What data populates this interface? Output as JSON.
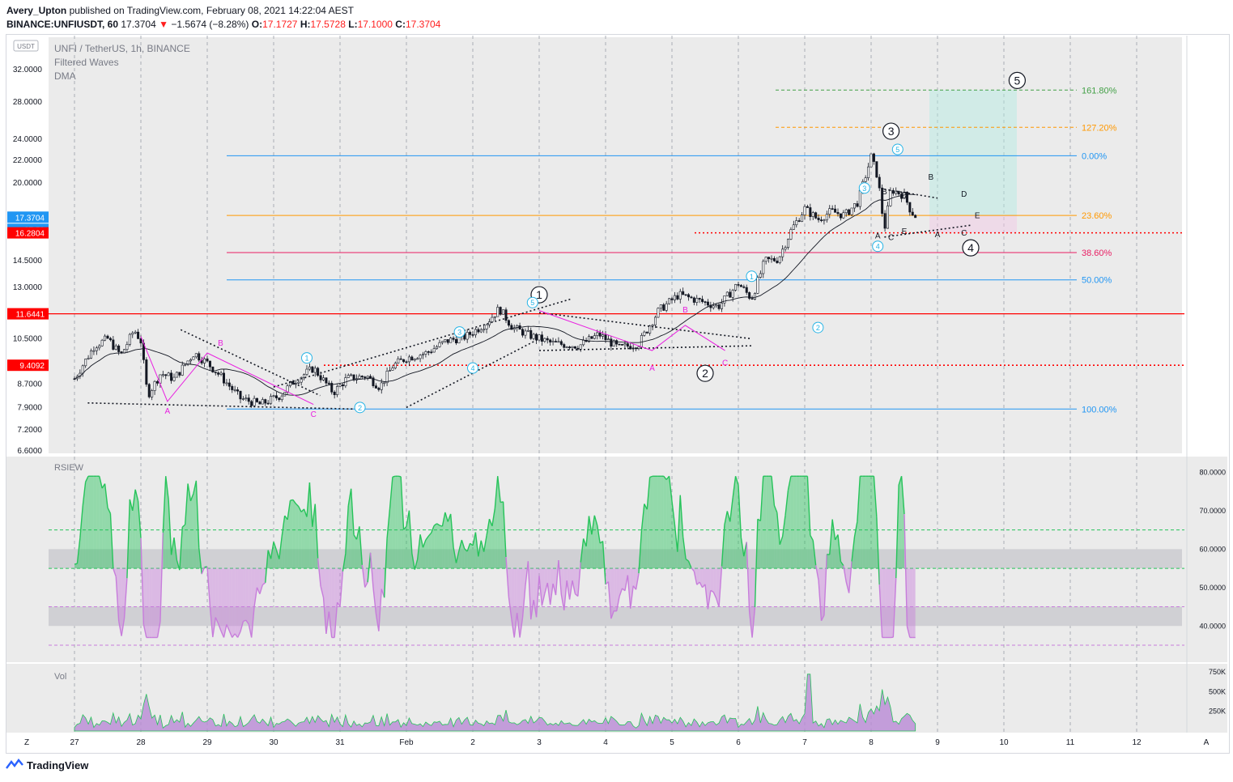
{
  "header": {
    "author": "Avery_Upton",
    "published_text": "published on TradingView.com, February 08, 2021 14:22:04 AEST",
    "symbol_line": "BINANCE:UNFIUSDT, 60",
    "last": "17.3704",
    "change": "−1.5674 (−8.28%)",
    "o": "17.1727",
    "h": "17.5728",
    "l": "17.1000",
    "c": "17.3704"
  },
  "legend": {
    "title": "UNFI / TetherUS, 1h, BINANCE",
    "ind1": "Filtered Waves",
    "ind2": "DMA",
    "rsi": "RSIEW",
    "vol": "Vol",
    "currency": "USDT"
  },
  "footer": {
    "brand": "TradingView"
  },
  "colors": {
    "candle": "#131722",
    "fib_blue": "#2196f3",
    "fib_orange": "#ff9800",
    "fib_crimson": "#e91e63",
    "fib_green": "#43a047",
    "red_level": "#ff0000",
    "rsi_up": "#26c35a",
    "rsi_down": "#c77ddb",
    "wave_marker": "#26b4e6",
    "corrective": "#e91ee0"
  },
  "chart_data": {
    "type": "candlestick",
    "price_axis": {
      "scale": "log",
      "ticks": [
        "32.0000",
        "28.0000",
        "24.0000",
        "22.0000",
        "20.0000",
        "17.3704",
        "16.2804",
        "14.5000",
        "13.0000",
        "11.6441",
        "10.5000",
        "9.4092",
        "8.7000",
        "7.9000",
        "7.2000",
        "6.6000"
      ],
      "ylim": [
        6.6,
        32.0
      ]
    },
    "price_tags": [
      {
        "value": "17.3704",
        "color": "#2196f3"
      },
      {
        "value": "37:59",
        "color": "#2196f3"
      },
      {
        "value": "16.2804",
        "color": "#ff0000"
      },
      {
        "value": "11.6441",
        "color": "#ff0000"
      },
      {
        "value": "9.4092",
        "color": "#ff0000"
      }
    ],
    "x_axis": {
      "ticks": [
        "27",
        "28",
        "29",
        "30",
        "31",
        "Feb",
        "2",
        "3",
        "4",
        "5",
        "6",
        "7",
        "8",
        "9",
        "10",
        "11",
        "12"
      ]
    },
    "fib_levels": [
      {
        "label": "161.80%",
        "price": 29.4,
        "color": "#43a047"
      },
      {
        "label": "127.20%",
        "price": 25.2,
        "color": "#ff9800"
      },
      {
        "label": "0.00%",
        "price": 22.4,
        "color": "#2196f3"
      },
      {
        "label": "23.60%",
        "price": 17.5,
        "color": "#ff9800"
      },
      {
        "label": "38.60%",
        "price": 15.0,
        "color": "#e91e63"
      },
      {
        "label": "50.00%",
        "price": 13.4,
        "color": "#2196f3"
      },
      {
        "label": "100.00%",
        "price": 7.85,
        "color": "#2196f3"
      }
    ],
    "horizontal_levels": [
      {
        "price": 11.6441,
        "style": "solid",
        "color": "#ff0000"
      },
      {
        "price": 16.2804,
        "style": "dotted",
        "color": "#ff0000"
      },
      {
        "price": 9.4092,
        "style": "dotted",
        "color": "#ff0000"
      }
    ],
    "price_path": [
      {
        "t": 0.0,
        "p": 8.9
      },
      {
        "t": 0.3,
        "p": 10.2
      },
      {
        "t": 0.5,
        "p": 10.5
      },
      {
        "t": 0.7,
        "p": 9.8
      },
      {
        "t": 0.9,
        "p": 10.9
      },
      {
        "t": 1.0,
        "p": 10.4
      },
      {
        "t": 1.1,
        "p": 8.3
      },
      {
        "t": 1.3,
        "p": 9.1
      },
      {
        "t": 1.5,
        "p": 8.9
      },
      {
        "t": 1.8,
        "p": 9.9
      },
      {
        "t": 2.0,
        "p": 9.5
      },
      {
        "t": 2.2,
        "p": 9.0
      },
      {
        "t": 2.5,
        "p": 8.2
      },
      {
        "t": 2.8,
        "p": 8.0
      },
      {
        "t": 3.1,
        "p": 8.3
      },
      {
        "t": 3.3,
        "p": 8.8
      },
      {
        "t": 3.6,
        "p": 9.3
      },
      {
        "t": 3.9,
        "p": 8.4
      },
      {
        "t": 4.1,
        "p": 8.9
      },
      {
        "t": 4.4,
        "p": 9.0
      },
      {
        "t": 4.6,
        "p": 8.6
      },
      {
        "t": 4.8,
        "p": 9.4
      },
      {
        "t": 5.0,
        "p": 9.7
      },
      {
        "t": 5.3,
        "p": 9.9
      },
      {
        "t": 5.6,
        "p": 10.4
      },
      {
        "t": 5.9,
        "p": 10.6
      },
      {
        "t": 6.2,
        "p": 11.2
      },
      {
        "t": 6.4,
        "p": 11.9
      },
      {
        "t": 6.6,
        "p": 11.0
      },
      {
        "t": 6.9,
        "p": 10.6
      },
      {
        "t": 7.2,
        "p": 10.3
      },
      {
        "t": 7.6,
        "p": 10.2
      },
      {
        "t": 7.9,
        "p": 10.7
      },
      {
        "t": 8.2,
        "p": 10.1
      },
      {
        "t": 8.5,
        "p": 10.3
      },
      {
        "t": 8.8,
        "p": 11.8
      },
      {
        "t": 9.1,
        "p": 12.6
      },
      {
        "t": 9.4,
        "p": 12.3
      },
      {
        "t": 9.7,
        "p": 12.0
      },
      {
        "t": 10.0,
        "p": 13.2
      },
      {
        "t": 10.2,
        "p": 12.4
      },
      {
        "t": 10.4,
        "p": 14.5
      },
      {
        "t": 10.6,
        "p": 14.6
      },
      {
        "t": 10.8,
        "p": 16.5
      },
      {
        "t": 11.0,
        "p": 18.0
      },
      {
        "t": 11.2,
        "p": 17.2
      },
      {
        "t": 11.4,
        "p": 17.8
      },
      {
        "t": 11.6,
        "p": 17.5
      },
      {
        "t": 11.8,
        "p": 18.5
      },
      {
        "t": 12.0,
        "p": 22.3
      },
      {
        "t": 12.1,
        "p": 20.5
      },
      {
        "t": 12.2,
        "p": 16.5
      },
      {
        "t": 12.3,
        "p": 19.5
      },
      {
        "t": 12.5,
        "p": 19.0
      },
      {
        "t": 12.6,
        "p": 17.8
      },
      {
        "t": 12.7,
        "p": 17.3
      }
    ],
    "wave_labels": [
      {
        "text": "①",
        "label": "1",
        "style": "circle-black",
        "t": 7.0,
        "p": 12.6
      },
      {
        "text": "②",
        "label": "2",
        "style": "circle-black",
        "t": 9.5,
        "p": 9.1
      },
      {
        "text": "③",
        "label": "3",
        "style": "circle-black",
        "t": 12.3,
        "p": 24.8
      },
      {
        "text": "④",
        "label": "4",
        "style": "circle-black",
        "t": 13.5,
        "p": 15.3
      },
      {
        "text": "⑤",
        "label": "5",
        "style": "circle-black",
        "t": 14.2,
        "p": 30.6
      }
    ],
    "sub_wave_labels": [
      {
        "label": "1",
        "t": 3.5,
        "p": 9.7
      },
      {
        "label": "2",
        "t": 4.3,
        "p": 7.9
      },
      {
        "label": "3",
        "t": 5.8,
        "p": 10.8
      },
      {
        "label": "4",
        "t": 6.0,
        "p": 9.3
      },
      {
        "label": "5",
        "t": 6.9,
        "p": 12.2
      },
      {
        "label": "1",
        "t": 10.2,
        "p": 13.6
      },
      {
        "label": "2",
        "t": 11.2,
        "p": 11.0
      },
      {
        "label": "3",
        "t": 11.9,
        "p": 19.6
      },
      {
        "label": "4",
        "t": 12.1,
        "p": 15.4
      },
      {
        "label": "5",
        "t": 12.4,
        "p": 23.0
      }
    ],
    "corrective_labels": [
      {
        "label": "A",
        "t": 1.4,
        "p": 7.7
      },
      {
        "label": "B",
        "t": 2.2,
        "p": 10.2
      },
      {
        "label": "C",
        "t": 3.6,
        "p": 7.6
      },
      {
        "label": "A",
        "t": 8.7,
        "p": 9.2
      },
      {
        "label": "B",
        "t": 9.2,
        "p": 11.7
      },
      {
        "label": "C",
        "t": 9.8,
        "p": 9.4
      }
    ],
    "triangle_labels": [
      {
        "label": "B",
        "t": 12.2,
        "p": 19.1
      },
      {
        "label": "D",
        "t": 12.5,
        "p": 18.8
      },
      {
        "label": "A",
        "t": 12.1,
        "p": 15.9
      },
      {
        "label": "C",
        "t": 12.3,
        "p": 15.8
      },
      {
        "label": "E",
        "t": 12.5,
        "p": 16.2
      },
      {
        "label": "B",
        "t": 12.9,
        "p": 20.3
      },
      {
        "label": "D",
        "t": 13.4,
        "p": 18.9
      },
      {
        "label": "A",
        "t": 13.0,
        "p": 16.0
      },
      {
        "label": "C",
        "t": 13.4,
        "p": 16.1
      },
      {
        "label": "E",
        "t": 13.6,
        "p": 17.3
      }
    ],
    "rsi_axis": {
      "ticks": [
        "80.0000",
        "70.0000",
        "60.0000",
        "50.0000",
        "40.0000"
      ],
      "ylim": [
        35,
        82
      ]
    },
    "rsi_levels": [
      {
        "value": 65,
        "color": "#26c35a"
      },
      {
        "value": 55,
        "color": "#26c35a"
      },
      {
        "value": 45,
        "color": "#c77ddb"
      },
      {
        "value": 35,
        "color": "#c77ddb"
      }
    ],
    "rsi_bands": [
      {
        "from": 55,
        "to": 60
      },
      {
        "from": 40,
        "to": 45
      }
    ],
    "vol_axis": {
      "ticks": [
        "750K",
        "500K",
        "250K"
      ],
      "ylim": [
        0,
        800000
      ]
    }
  }
}
